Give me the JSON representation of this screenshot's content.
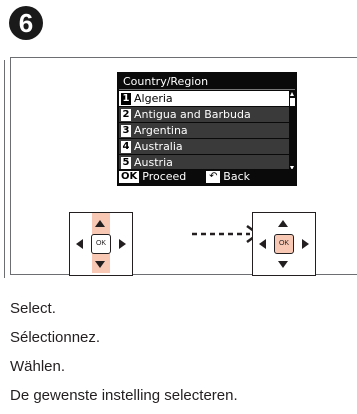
{
  "step": {
    "number": "6"
  },
  "lcd": {
    "title": "Country/Region",
    "items": [
      {
        "num": "1",
        "label": "Algeria",
        "selected": true
      },
      {
        "num": "2",
        "label": "Antigua and Barbuda",
        "selected": false
      },
      {
        "num": "3",
        "label": "Argentina",
        "selected": false
      },
      {
        "num": "4",
        "label": "Australia",
        "selected": false
      },
      {
        "num": "5",
        "label": "Austria",
        "selected": false
      }
    ],
    "footer": {
      "ok_chip": "OK",
      "proceed": "Proceed",
      "back_icon": "↶",
      "back": "Back"
    }
  },
  "dpad": {
    "ok_label": "OK"
  },
  "instructions": {
    "en": "Select.",
    "fr": "Sélectionnez.",
    "de": "Wählen.",
    "nl": "De gewenste instelling selecteren."
  },
  "colors": {
    "highlight": "#f8c8b4",
    "lcd_bg": "#0a0a0a",
    "text": "#231f20"
  }
}
